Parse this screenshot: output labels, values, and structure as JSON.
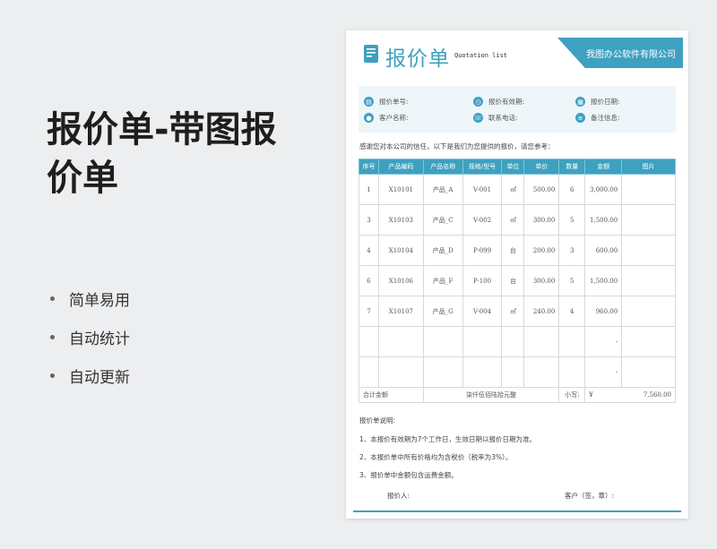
{
  "promo": {
    "title_line1": "报价单-带图报",
    "title_line2": "价单",
    "features": [
      "简单易用",
      "自动统计",
      "自动更新"
    ]
  },
  "sheet": {
    "title": "报价单",
    "subtitle": "Quotation list",
    "company": "我图办公软件有限公司",
    "accent_color": "#3ea1bf",
    "info": {
      "quote_no": "报价单号:",
      "valid_period": "报价有效期:",
      "quote_date": "报价日期:",
      "customer": "客户名称:",
      "phone": "联系电话:",
      "remarks": "备注信息:"
    },
    "thanks": "感谢您对本公司的信任，以下是我们为您提供的报价，请您参考：",
    "table": {
      "headers": [
        "序号",
        "产品编码",
        "产品名称",
        "规格/型号",
        "单位",
        "单价",
        "数量",
        "金额",
        "图片"
      ],
      "rows": [
        [
          "1",
          "X10101",
          "产品_A",
          "V-001",
          "㎡",
          "500.00",
          "6",
          "3,000.00",
          ""
        ],
        [
          "3",
          "X10103",
          "产品_C",
          "V-002",
          "㎡",
          "300.00",
          "5",
          "1,500.00",
          ""
        ],
        [
          "4",
          "X10104",
          "产品_D",
          "P-099",
          "台",
          "200.00",
          "3",
          "600.00",
          ""
        ],
        [
          "6",
          "X10106",
          "产品_F",
          "P-100",
          "台",
          "300.00",
          "5",
          "1,500.00",
          ""
        ],
        [
          "7",
          "X10107",
          "产品_G",
          "V-004",
          "㎡",
          "240.00",
          "4",
          "960.00",
          ""
        ],
        [
          "",
          "",
          "",
          "",
          "",
          "",
          "",
          "-",
          ""
        ],
        [
          "",
          "",
          "",
          "",
          "",
          "",
          "",
          "-",
          ""
        ]
      ],
      "total_label": "合计金额",
      "total_words": "柒仟伍佰陆拾元整",
      "subtotal_label": "小写:",
      "currency": "¥",
      "total_value": "7,560.00"
    },
    "notes": {
      "title": "报价单说明:",
      "items": [
        "1、本报价有效期为7个工作日，生效日期以报价日期为准。",
        "2、本报价单中所有价格均为含税价（税率为3%）。",
        "3、报价单中金额包含运费金额。"
      ]
    },
    "sign_quoter": "报价人:",
    "sign_customer": "客户（签，章）:"
  }
}
